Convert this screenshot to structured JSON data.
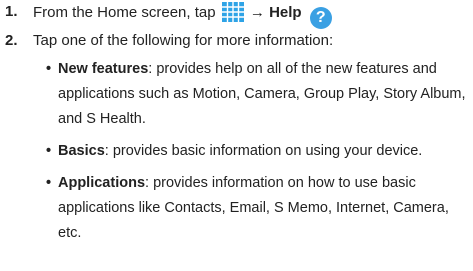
{
  "steps": [
    {
      "number": "1.",
      "text_before": "From the Home screen, tap",
      "arrow": "→",
      "target_label": "Help",
      "apps_icon": "apps-grid-icon",
      "help_icon": "help-question-icon",
      "help_glyph": "?",
      "colors": {
        "apps_icon": "#2ea3e6",
        "help_icon": "#3aa0e3"
      }
    },
    {
      "number": "2.",
      "text": "Tap one of the following for more information:"
    }
  ],
  "bullets": [
    {
      "bullet_char": "•",
      "term": "New features",
      "lines": [
        ": provides help on all of the new features and",
        "applications such as Motion, Camera, Group Play, Story Album,",
        "and S Health."
      ]
    },
    {
      "bullet_char": "•",
      "term": "Basics",
      "lines": [
        ": provides basic information on using your device."
      ]
    },
    {
      "bullet_char": "•",
      "term": "Applications",
      "lines": [
        ": provides information on how to use basic",
        "applications like Contacts, Email, S Memo, Internet, Camera,",
        "etc."
      ]
    }
  ]
}
